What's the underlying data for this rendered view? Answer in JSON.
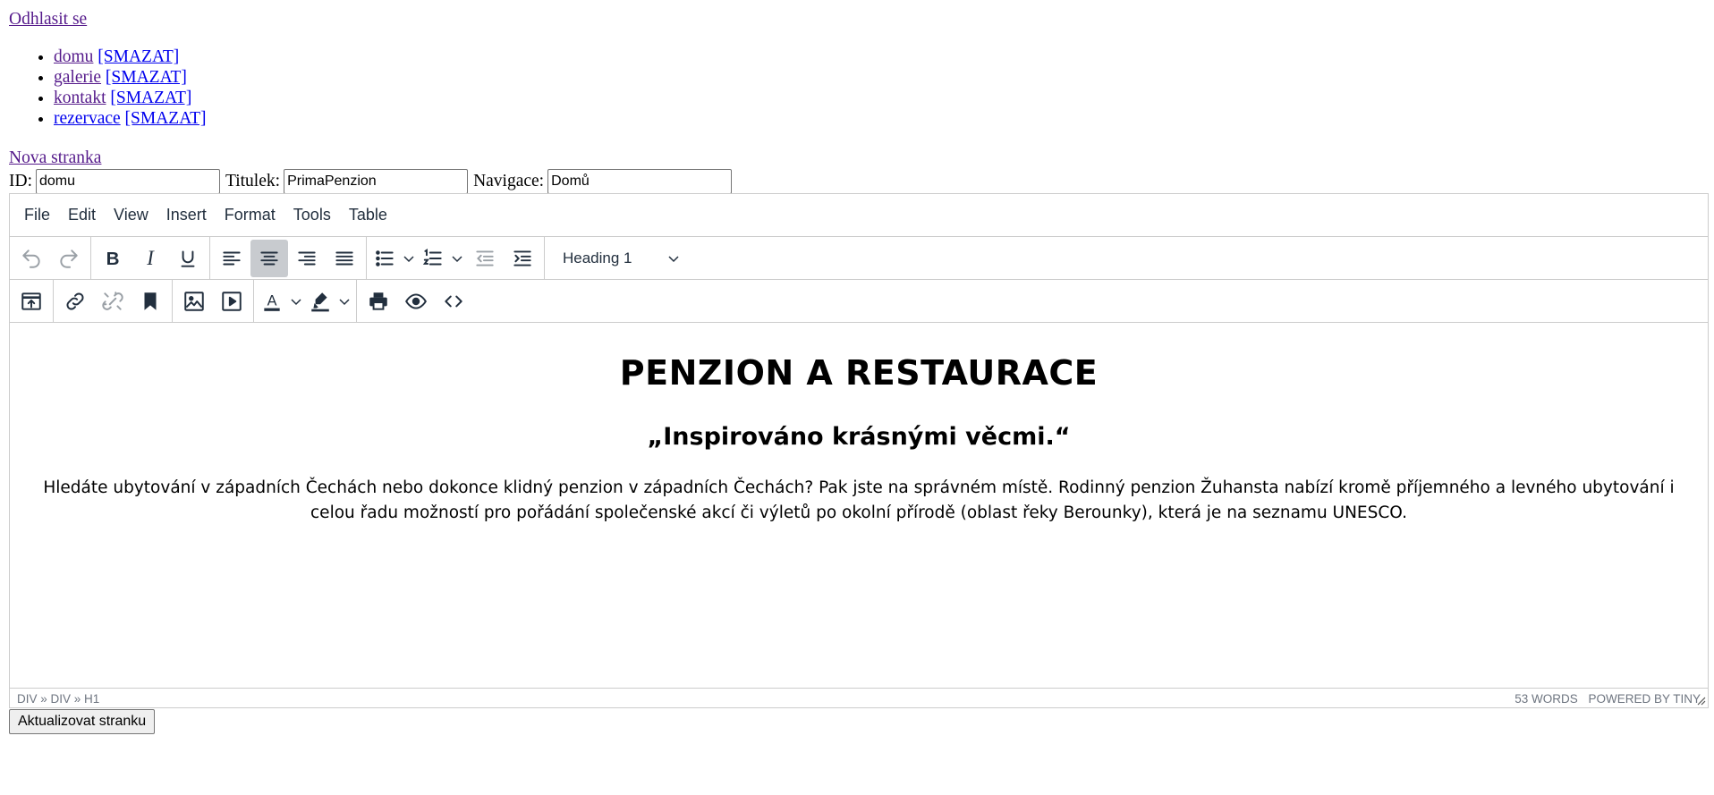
{
  "logout_label": "Odhlasit se",
  "pages": [
    {
      "name": "domu",
      "delete": "[SMAZAT]"
    },
    {
      "name": "galerie",
      "delete": "[SMAZAT]"
    },
    {
      "name": "kontakt",
      "delete": "[SMAZAT]"
    },
    {
      "name": "rezervace",
      "delete": "[SMAZAT]"
    }
  ],
  "new_page_label": "Nova stranka",
  "form": {
    "id_label": "ID:",
    "id_value": "domu",
    "title_label": "Titulek:",
    "title_value": "PrimaPenzion",
    "nav_label": "Navigace:",
    "nav_value": "Domů"
  },
  "editor": {
    "menu": [
      "File",
      "Edit",
      "View",
      "Insert",
      "Format",
      "Tools",
      "Table"
    ],
    "block_format": "Heading 1",
    "toolbar_icons": {
      "row1": [
        "undo-icon",
        "redo-icon",
        "bold-icon",
        "italic-icon",
        "underline-icon",
        "align-left-icon",
        "align-center-icon",
        "align-right-icon",
        "align-justify-icon",
        "bullet-list-icon",
        "numbered-list-icon",
        "outdent-icon",
        "indent-icon"
      ],
      "row2": [
        "upload-icon",
        "link-icon",
        "unlink-icon",
        "bookmark-icon",
        "image-icon",
        "media-icon",
        "text-color-icon",
        "highlight-icon",
        "print-icon",
        "preview-icon",
        "code-icon"
      ]
    },
    "content": {
      "h1": "PENZION A RESTAURACE",
      "h2": "„Inspirováno krásnými věcmi.“",
      "paragraph": "Hledáte ubytování v západních Čechách nebo dokonce klidný penzion v západních Čechách? Pak jste na správném místě. Rodinný penzion Žuhansta nabízí kromě příjemného a levného ubytování i celou řadu možností pro pořádání společenské akcí či výletů po okolní přírodě (oblast řeky Berounky), která je na seznamu UNESCO."
    },
    "status": {
      "path": "DIV » DIV » H1",
      "words": "53 WORDS",
      "powered": "POWERED BY TINY"
    }
  },
  "submit_label": "Aktualizovat stranku",
  "colors": {
    "accent_active": "#c8cbcf",
    "toolbar_text": "#222f3e",
    "border": "#cccccc"
  }
}
